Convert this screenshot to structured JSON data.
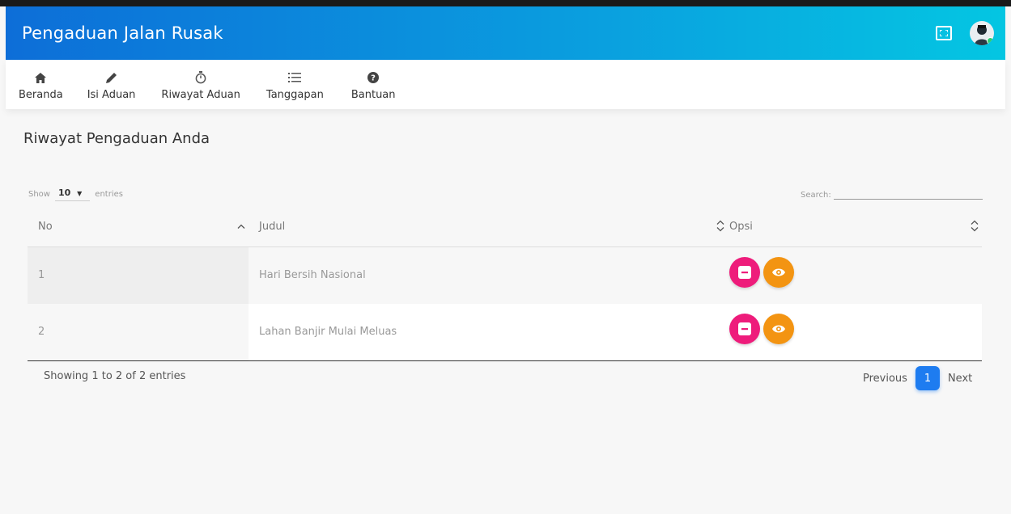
{
  "app": {
    "title": "Pengaduan Jalan Rusak"
  },
  "nav": {
    "items": [
      {
        "label": "Beranda",
        "icon": "home-icon"
      },
      {
        "label": "Isi Aduan",
        "icon": "pencil-icon"
      },
      {
        "label": "Riwayat Aduan",
        "icon": "stopwatch-icon"
      },
      {
        "label": "Tanggapan",
        "icon": "list-icon"
      },
      {
        "label": "Bantuan",
        "icon": "help-icon"
      }
    ]
  },
  "page": {
    "title": "Riwayat Pengaduan Anda"
  },
  "table_controls": {
    "show_label": "Show",
    "length_value": "10",
    "entries_label": "entries",
    "search_label": "Search:",
    "search_value": ""
  },
  "table": {
    "columns": [
      "No",
      "Judul",
      "Opsi"
    ],
    "rows": [
      {
        "no": "1",
        "judul": "Hari Bersih Nasional"
      },
      {
        "no": "2",
        "judul": "Lahan Banjir Mulai Meluas"
      }
    ]
  },
  "footer": {
    "info": "Showing 1 to 2 of 2 entries",
    "previous": "Previous",
    "page": "1",
    "next": "Next"
  },
  "colors": {
    "header_start": "#0d6ed8",
    "header_end": "#04c6e2",
    "delete_button": "#ee1c7b",
    "view_button": "#f39412",
    "active_page": "#1e7cf0"
  }
}
